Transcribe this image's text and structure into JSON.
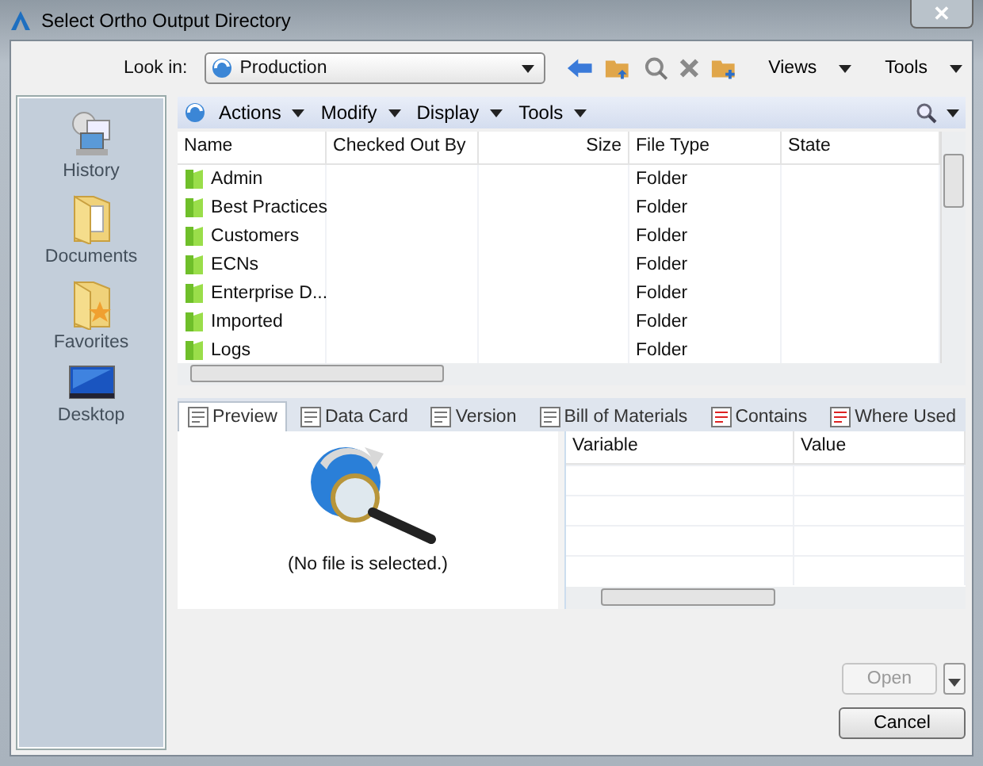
{
  "window": {
    "title": "Select Ortho Output Directory",
    "close": "✕"
  },
  "look_in": {
    "label": "Look in:",
    "value": "Production"
  },
  "toolbar": {
    "views": "Views",
    "tools": "Tools"
  },
  "places": [
    {
      "label": "History",
      "kind": "history"
    },
    {
      "label": "Documents",
      "kind": "documents"
    },
    {
      "label": "Favorites",
      "kind": "favorites"
    },
    {
      "label": "Desktop",
      "kind": "desktop"
    }
  ],
  "command_bar": [
    "Actions",
    "Modify",
    "Display",
    "Tools"
  ],
  "table": {
    "columns": [
      "Name",
      "Checked Out By",
      "Size",
      "File Type",
      "State"
    ],
    "rows": [
      {
        "name": "Admin",
        "file_type": "Folder"
      },
      {
        "name": "Best Practices",
        "file_type": "Folder"
      },
      {
        "name": "Customers",
        "file_type": "Folder"
      },
      {
        "name": "ECNs",
        "file_type": "Folder"
      },
      {
        "name": "Enterprise D...",
        "file_type": "Folder"
      },
      {
        "name": "Imported",
        "file_type": "Folder"
      },
      {
        "name": "Logs",
        "file_type": "Folder"
      }
    ]
  },
  "tabs": [
    {
      "label": "Preview",
      "selected": true
    },
    {
      "label": "Data Card",
      "selected": false
    },
    {
      "label": "Version",
      "selected": false
    },
    {
      "label": "Bill of Materials",
      "selected": false
    },
    {
      "label": "Contains",
      "selected": false
    },
    {
      "label": "Where Used",
      "selected": false
    }
  ],
  "preview": {
    "message": "(No file is selected.)"
  },
  "properties": {
    "columns": [
      "Variable",
      "Value"
    ]
  },
  "buttons": [
    {
      "label": "Open",
      "disabled": true
    },
    {
      "label": "Cancel",
      "disabled": false
    }
  ]
}
